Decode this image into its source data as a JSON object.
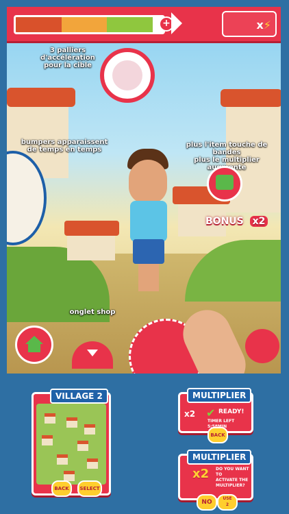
{
  "hud": {
    "progress_fill": 0.93,
    "progress_colors": [
      "#d9512b",
      "#f2a53b",
      "#8fc73e"
    ],
    "plus_label": "+",
    "multiplier_label": "x"
  },
  "annotations": {
    "acceleration": "3 palliers d'accélération\npour la cible",
    "bumpers": "bumpers apparaissent\nde temps en temps",
    "multiplier_hint": "plus l'item touche de bandes\nplus le multiplier augmente",
    "shop_tab": "onglet shop"
  },
  "bonus": {
    "text": "BONUS",
    "value": "x2"
  },
  "village_panel": {
    "title": "VILLAGE 2",
    "back_label": "BACK",
    "select_label": "SELECT"
  },
  "multiplier_panel_1": {
    "title": "MULTIPLIER",
    "multiplier": "x2",
    "ready": "READY!",
    "timer": "TIMER LEFT 5:58MIN",
    "back_label": "BACK"
  },
  "multiplier_panel_2": {
    "title": "MULTIPLIER",
    "multiplier": "x2",
    "question": "DO YOU WANT TO\nACTIVATE THE\nMULTIPLIER?",
    "no_label": "NO",
    "use_label": "USE",
    "use_count": "2"
  },
  "colors": {
    "accent": "#e8334a",
    "background": "#2e6fa3",
    "tag": "#1f62a8"
  }
}
